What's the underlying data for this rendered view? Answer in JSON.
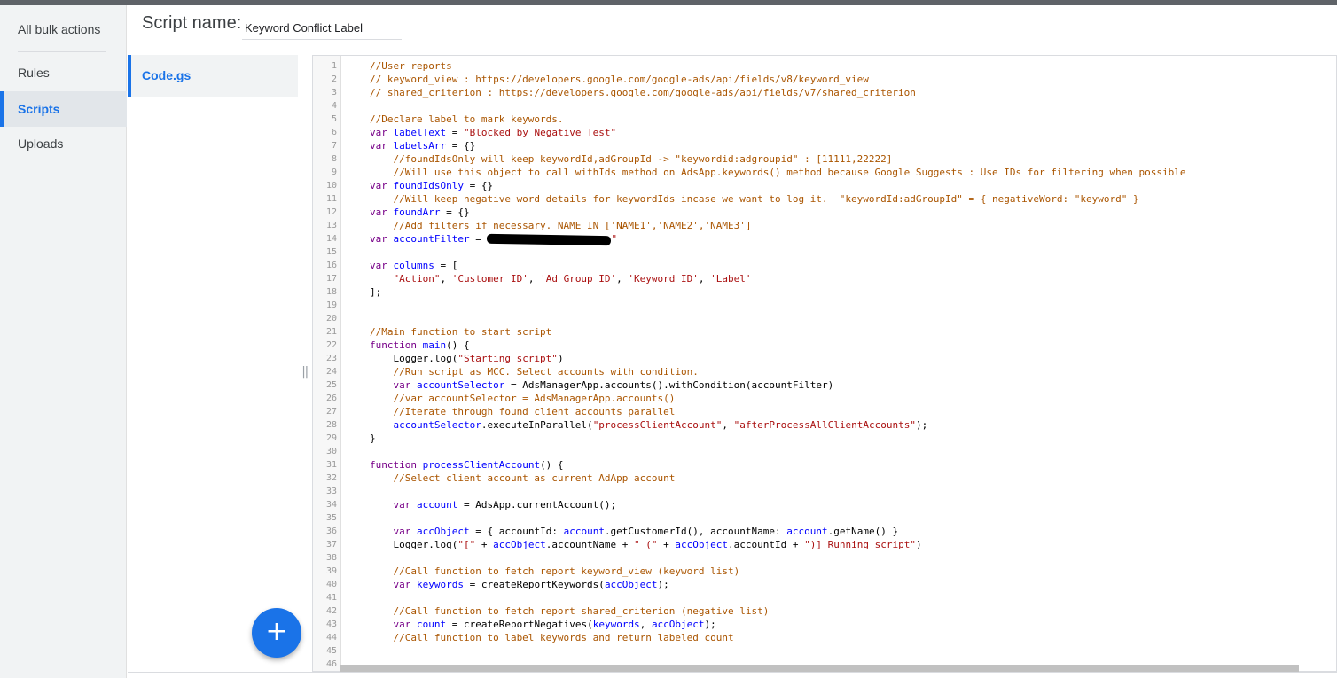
{
  "nav": {
    "items": [
      {
        "label": "All bulk actions"
      },
      {
        "label": "Rules"
      },
      {
        "label": "Scripts"
      },
      {
        "label": "Uploads"
      }
    ],
    "active": "Scripts"
  },
  "header": {
    "script_name_label": "Script name:",
    "script_name_value": "Keyword Conflict Label"
  },
  "files": [
    {
      "label": "Code.gs"
    }
  ],
  "editor": {
    "lines": [
      "//User reports",
      "// keyword_view : https://developers.google.com/google-ads/api/fields/v8/keyword_view",
      "// shared_criterion : https://developers.google.com/google-ads/api/fields/v7/shared_criterion",
      "",
      "//Declare label to mark keywords.",
      "var labelText = \"Blocked by Negative Test\"",
      "var labelsArr = {}",
      "    //foundIdsOnly will keep keywordId,adGroupId -> \"keywordid:adgroupid\" : [11111,22222]",
      "    //Will use this object to call withIds method on AdsApp.keywords() method because Google Suggests : Use IDs for filtering when possible",
      "var foundIdsOnly = {}",
      "    //Will keep negative word details for keywordIds incase we want to log it.  \"keywordId:adGroupId\" = { negativeWord: \"keyword\" }",
      "var foundArr = {}",
      "    //Add filters if necessary. NAME IN ['NAME1','NAME2','NAME3']",
      "var accountFilter = \"",
      "",
      "var columns = [",
      "    \"Action\", 'Customer ID', 'Ad Group ID', 'Keyword ID', 'Label'",
      "];",
      "",
      "",
      "//Main function to start script",
      "function main() {",
      "    Logger.log(\"Starting script\")",
      "    //Run script as MCC. Select accounts with condition.",
      "    var accountSelector = AdsManagerApp.accounts().withCondition(accountFilter)",
      "    //var accountSelector = AdsManagerApp.accounts()",
      "    //Iterate through found client accounts parallel",
      "    accountSelector.executeInParallel(\"processClientAccount\", \"afterProcessAllClientAccounts\");",
      "}",
      "",
      "function processClientAccount() {",
      "    //Select client account as current AdApp account",
      "",
      "    var account = AdsApp.currentAccount();",
      "",
      "    var accObject = { accountId: account.getCustomerId(), accountName: account.getName() }",
      "    Logger.log(\"[\" + accObject.accountName + \" (\" + accObject.accountId + \")] Running script\")",
      "",
      "    //Call function to fetch report keyword_view (keyword list)",
      "    var keywords = createReportKeywords(accObject);",
      "",
      "    //Call function to fetch report shared_criterion (negative list)",
      "    var count = createReportNegatives(keywords, accObject);",
      "    //Call function to label keywords and return labeled count",
      "",
      ""
    ]
  },
  "fab": {
    "label": "+"
  }
}
